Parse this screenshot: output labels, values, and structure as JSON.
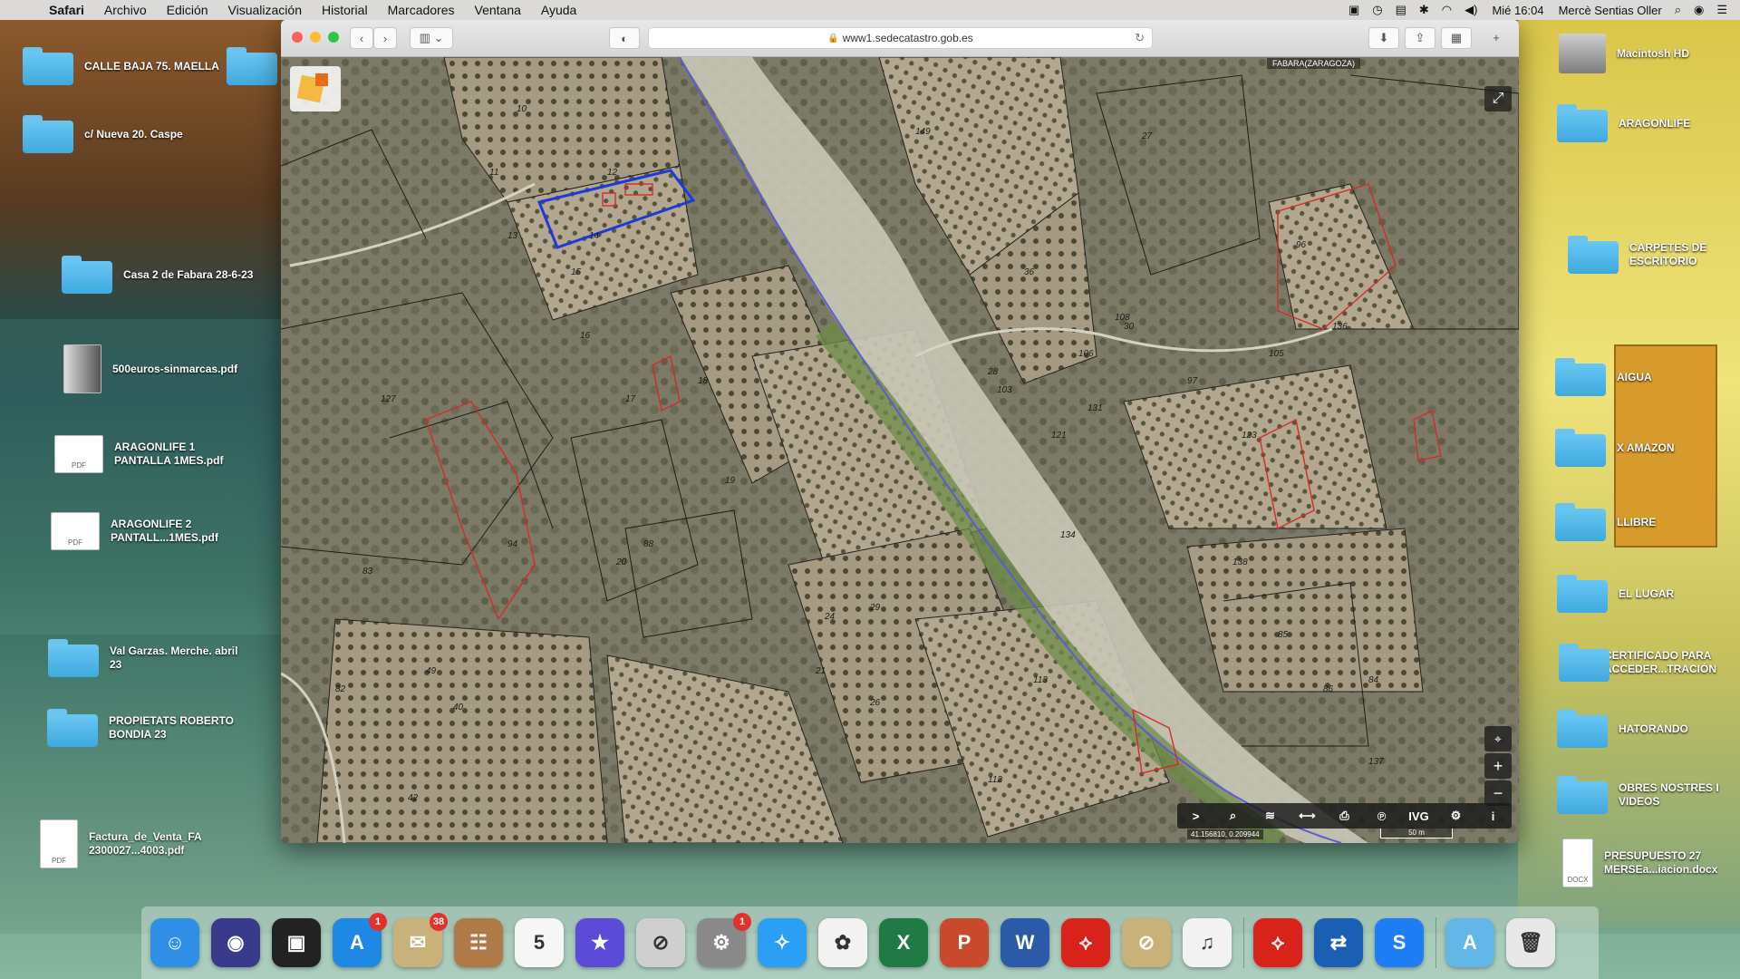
{
  "menubar": {
    "app": "Safari",
    "items": [
      "Archivo",
      "Edición",
      "Visualización",
      "Historial",
      "Marcadores",
      "Ventana",
      "Ayuda"
    ],
    "clock": "Mié 16:04",
    "user": "Mercè Sentias Oller"
  },
  "desktop_left": [
    {
      "label": "CALLE BAJA 75. MAELLA",
      "type": "folder"
    },
    {
      "label": "c/ Nueva 20. Caspe",
      "type": "folder"
    },
    {
      "label": "Casa 2 de Fabara 28-6-23",
      "type": "folder"
    },
    {
      "label": "500euros-sinmarcas.pdf",
      "type": "pdf"
    },
    {
      "label": "ARAGONLIFE 1 PANTALLA 1MES.pdf",
      "type": "pdf"
    },
    {
      "label": "ARAGONLIFE 2 PANTALL...1MES.pdf",
      "type": "pdf"
    },
    {
      "label": "Val Garzas. Merche. abril 23",
      "type": "folder"
    },
    {
      "label": "PROPIETATS ROBERTO BONDIA 23",
      "type": "folder"
    },
    {
      "label": "Factura_de_Venta_FA 2300027...4003.pdf",
      "type": "pdf"
    }
  ],
  "desktop_right": [
    {
      "label": "Macintosh HD",
      "type": "drive"
    },
    {
      "label": "ARAGONLIFE",
      "type": "folder"
    },
    {
      "label": "CARPETES DE ESCRITORIO",
      "type": "folder"
    },
    {
      "label": "AIGUA",
      "type": "folder"
    },
    {
      "label": "X AMAZON",
      "type": "folder"
    },
    {
      "label": "LLIBRE",
      "type": "folder"
    },
    {
      "label": "EL LUGAR",
      "type": "folder"
    },
    {
      "label": "CERTIFICADO PARA ACCEDER...TRACIÓN",
      "type": "folder"
    },
    {
      "label": "HATORANDO",
      "type": "folder"
    },
    {
      "label": "OBRES NOSTRES I VIDEOS",
      "type": "folder"
    },
    {
      "label": "PRESUPUESTO 27 MERSEa...iacion.docx",
      "type": "docx"
    }
  ],
  "safari": {
    "url": "www1.sedecatastro.gob.es"
  },
  "map": {
    "region_label": "FABARA(ZARAGOZA)",
    "coords": "41.156810, 0.209944",
    "scale": "50 m",
    "tools": [
      ">",
      "⌕",
      "≋",
      "⟷",
      "⎙",
      "℗",
      "IVG",
      "⚙",
      "i"
    ],
    "parcel_numbers": [
      "10",
      "11",
      "12",
      "13",
      "14",
      "15",
      "16",
      "17",
      "18",
      "19",
      "20",
      "21",
      "24",
      "26",
      "27",
      "28",
      "29",
      "30",
      "36",
      "40",
      "42",
      "49",
      "82",
      "83",
      "84",
      "85",
      "86",
      "88",
      "94",
      "96",
      "97",
      "103",
      "105",
      "106",
      "108",
      "112",
      "113",
      "121",
      "123",
      "127",
      "131",
      "134",
      "136",
      "137",
      "138",
      "149"
    ]
  },
  "dock": {
    "apps": [
      {
        "name": "Finder",
        "glyph": "☺",
        "color": "#2f8fe6"
      },
      {
        "name": "Siri",
        "glyph": "◉",
        "color": "#3a3a8c"
      },
      {
        "name": "Photo Booth",
        "glyph": "▣",
        "color": "#222"
      },
      {
        "name": "App Store",
        "glyph": "A",
        "color": "#1e88e5",
        "badge": "1"
      },
      {
        "name": "Mail",
        "glyph": "✉",
        "color": "#c9b27a",
        "badge": "38"
      },
      {
        "name": "Contacts",
        "glyph": "☷",
        "color": "#b07a48"
      },
      {
        "name": "Calendar",
        "glyph": "5",
        "color": "#f6f6f6"
      },
      {
        "name": "iMovie",
        "glyph": "★",
        "color": "#5b4bd6"
      },
      {
        "name": "Disabled App",
        "glyph": "⊘",
        "color": "#cfcfcf"
      },
      {
        "name": "System Preferences",
        "glyph": "⚙",
        "color": "#8a8a8a",
        "badge": "1"
      },
      {
        "name": "Safari",
        "glyph": "✧",
        "color": "#2b9ef5"
      },
      {
        "name": "Photos",
        "glyph": "✿",
        "color": "#f2f2f2"
      },
      {
        "name": "Excel",
        "glyph": "X",
        "color": "#1f7a45"
      },
      {
        "name": "PowerPoint",
        "glyph": "P",
        "color": "#c8492b"
      },
      {
        "name": "Word",
        "glyph": "W",
        "color": "#2b5aa8"
      },
      {
        "name": "Acrobat",
        "glyph": "⟡",
        "color": "#d8231a"
      },
      {
        "name": "Disabled App 2",
        "glyph": "⊘",
        "color": "#c9b27a"
      },
      {
        "name": "Music",
        "glyph": "♫",
        "color": "#f2f2f2"
      },
      {
        "name": "Acrobat Reader",
        "glyph": "⟡",
        "color": "#d8231a"
      },
      {
        "name": "TeamViewer",
        "glyph": "⇄",
        "color": "#1b5fb4"
      },
      {
        "name": "Shazam",
        "glyph": "S",
        "color": "#1c7ef2"
      }
    ],
    "right": [
      {
        "name": "Applications",
        "glyph": "A",
        "color": "#62b6e8"
      },
      {
        "name": "Trash",
        "glyph": "🗑",
        "color": "#e8e8e8"
      }
    ]
  }
}
